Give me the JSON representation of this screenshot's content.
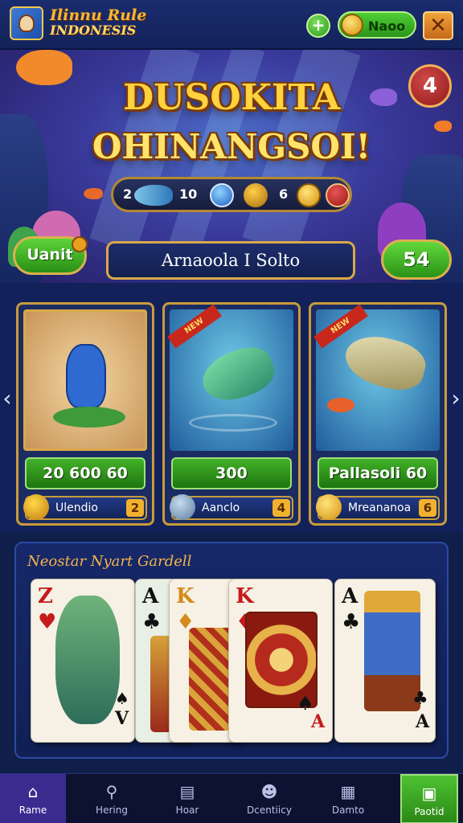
{
  "header": {
    "logo_line1": "Ilinnu Rule",
    "logo_line2": "INDONESIS",
    "add_symbol": "+",
    "coin_balance": "Naoo",
    "close_symbol": "✕"
  },
  "hero": {
    "title_line1": "DUSOKITA",
    "title_line2": "OHINANGSOI!",
    "level": "4",
    "rewards": [
      {
        "value": "2",
        "icon": "fish-icon"
      },
      {
        "value": "10",
        "icon": "blue-orb-icon"
      },
      {
        "value": "6",
        "icon": "gold-coin-icon"
      }
    ],
    "action_button": "Uanit",
    "name_field": "Arnaoola I Solto",
    "score": "54"
  },
  "cards": [
    {
      "price": "20 600 60",
      "label": "Ulendio",
      "count": "2",
      "ribbon": "",
      "art": "creature"
    },
    {
      "price": "300",
      "label": "Aanclo",
      "count": "4",
      "ribbon": "NEW",
      "art": "fish"
    },
    {
      "price": "Pallasoli 60",
      "label": "Mreananoa",
      "count": "6",
      "ribbon": "NEW",
      "art": "fish"
    }
  ],
  "playing_cards": {
    "title": "Neostar Nyart Gardell",
    "cards": [
      {
        "rank": "Z",
        "suit": "♥",
        "color": "red",
        "corner": "V",
        "corner_suit": "♠"
      },
      {
        "rank": "A",
        "suit": "♣",
        "color": "black"
      },
      {
        "rank": "K",
        "suit": "♦",
        "color": "red"
      },
      {
        "rank": "K",
        "suit": "♦",
        "color": "red",
        "corner": "A",
        "corner_suit": "♠"
      },
      {
        "rank": "A",
        "suit": "♣",
        "color": "black",
        "corner": "A",
        "corner_suit": "♣"
      }
    ]
  },
  "nav": [
    {
      "label": "Rame",
      "icon": "home-icon"
    },
    {
      "label": "Hering",
      "icon": "search-icon"
    },
    {
      "label": "Hoar",
      "icon": "book-icon"
    },
    {
      "label": "Dcentiicy",
      "icon": "user-icon"
    },
    {
      "label": "Damto",
      "icon": "calendar-icon"
    },
    {
      "label": "Paotid",
      "icon": "card-icon"
    }
  ],
  "colors": {
    "gold": "#c89b3c",
    "green": "#42b128",
    "navy": "#12215a",
    "title_yellow": "#ffd23e"
  }
}
